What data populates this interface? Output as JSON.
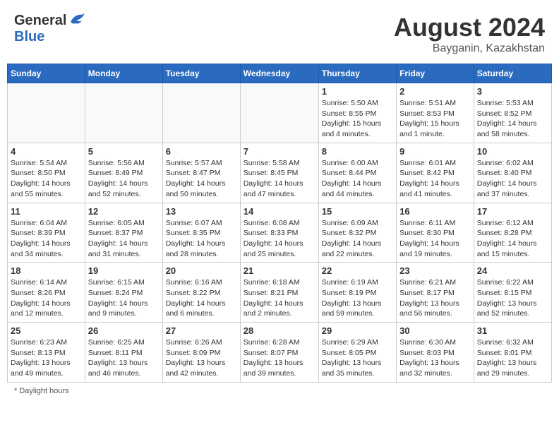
{
  "header": {
    "logo_general": "General",
    "logo_blue": "Blue",
    "month_year": "August 2024",
    "location": "Bayganin, Kazakhstan"
  },
  "days_of_week": [
    "Sunday",
    "Monday",
    "Tuesday",
    "Wednesday",
    "Thursday",
    "Friday",
    "Saturday"
  ],
  "footer": {
    "daylight_label": "Daylight hours"
  },
  "weeks": [
    [
      {
        "day": "",
        "info": ""
      },
      {
        "day": "",
        "info": ""
      },
      {
        "day": "",
        "info": ""
      },
      {
        "day": "",
        "info": ""
      },
      {
        "day": "1",
        "info": "Sunrise: 5:50 AM\nSunset: 8:55 PM\nDaylight: 15 hours\nand 4 minutes."
      },
      {
        "day": "2",
        "info": "Sunrise: 5:51 AM\nSunset: 8:53 PM\nDaylight: 15 hours\nand 1 minute."
      },
      {
        "day": "3",
        "info": "Sunrise: 5:53 AM\nSunset: 8:52 PM\nDaylight: 14 hours\nand 58 minutes."
      }
    ],
    [
      {
        "day": "4",
        "info": "Sunrise: 5:54 AM\nSunset: 8:50 PM\nDaylight: 14 hours\nand 55 minutes."
      },
      {
        "day": "5",
        "info": "Sunrise: 5:56 AM\nSunset: 8:49 PM\nDaylight: 14 hours\nand 52 minutes."
      },
      {
        "day": "6",
        "info": "Sunrise: 5:57 AM\nSunset: 8:47 PM\nDaylight: 14 hours\nand 50 minutes."
      },
      {
        "day": "7",
        "info": "Sunrise: 5:58 AM\nSunset: 8:45 PM\nDaylight: 14 hours\nand 47 minutes."
      },
      {
        "day": "8",
        "info": "Sunrise: 6:00 AM\nSunset: 8:44 PM\nDaylight: 14 hours\nand 44 minutes."
      },
      {
        "day": "9",
        "info": "Sunrise: 6:01 AM\nSunset: 8:42 PM\nDaylight: 14 hours\nand 41 minutes."
      },
      {
        "day": "10",
        "info": "Sunrise: 6:02 AM\nSunset: 8:40 PM\nDaylight: 14 hours\nand 37 minutes."
      }
    ],
    [
      {
        "day": "11",
        "info": "Sunrise: 6:04 AM\nSunset: 8:39 PM\nDaylight: 14 hours\nand 34 minutes."
      },
      {
        "day": "12",
        "info": "Sunrise: 6:05 AM\nSunset: 8:37 PM\nDaylight: 14 hours\nand 31 minutes."
      },
      {
        "day": "13",
        "info": "Sunrise: 6:07 AM\nSunset: 8:35 PM\nDaylight: 14 hours\nand 28 minutes."
      },
      {
        "day": "14",
        "info": "Sunrise: 6:08 AM\nSunset: 8:33 PM\nDaylight: 14 hours\nand 25 minutes."
      },
      {
        "day": "15",
        "info": "Sunrise: 6:09 AM\nSunset: 8:32 PM\nDaylight: 14 hours\nand 22 minutes."
      },
      {
        "day": "16",
        "info": "Sunrise: 6:11 AM\nSunset: 8:30 PM\nDaylight: 14 hours\nand 19 minutes."
      },
      {
        "day": "17",
        "info": "Sunrise: 6:12 AM\nSunset: 8:28 PM\nDaylight: 14 hours\nand 15 minutes."
      }
    ],
    [
      {
        "day": "18",
        "info": "Sunrise: 6:14 AM\nSunset: 8:26 PM\nDaylight: 14 hours\nand 12 minutes."
      },
      {
        "day": "19",
        "info": "Sunrise: 6:15 AM\nSunset: 8:24 PM\nDaylight: 14 hours\nand 9 minutes."
      },
      {
        "day": "20",
        "info": "Sunrise: 6:16 AM\nSunset: 8:22 PM\nDaylight: 14 hours\nand 6 minutes."
      },
      {
        "day": "21",
        "info": "Sunrise: 6:18 AM\nSunset: 8:21 PM\nDaylight: 14 hours\nand 2 minutes."
      },
      {
        "day": "22",
        "info": "Sunrise: 6:19 AM\nSunset: 8:19 PM\nDaylight: 13 hours\nand 59 minutes."
      },
      {
        "day": "23",
        "info": "Sunrise: 6:21 AM\nSunset: 8:17 PM\nDaylight: 13 hours\nand 56 minutes."
      },
      {
        "day": "24",
        "info": "Sunrise: 6:22 AM\nSunset: 8:15 PM\nDaylight: 13 hours\nand 52 minutes."
      }
    ],
    [
      {
        "day": "25",
        "info": "Sunrise: 6:23 AM\nSunset: 8:13 PM\nDaylight: 13 hours\nand 49 minutes."
      },
      {
        "day": "26",
        "info": "Sunrise: 6:25 AM\nSunset: 8:11 PM\nDaylight: 13 hours\nand 46 minutes."
      },
      {
        "day": "27",
        "info": "Sunrise: 6:26 AM\nSunset: 8:09 PM\nDaylight: 13 hours\nand 42 minutes."
      },
      {
        "day": "28",
        "info": "Sunrise: 6:28 AM\nSunset: 8:07 PM\nDaylight: 13 hours\nand 39 minutes."
      },
      {
        "day": "29",
        "info": "Sunrise: 6:29 AM\nSunset: 8:05 PM\nDaylight: 13 hours\nand 35 minutes."
      },
      {
        "day": "30",
        "info": "Sunrise: 6:30 AM\nSunset: 8:03 PM\nDaylight: 13 hours\nand 32 minutes."
      },
      {
        "day": "31",
        "info": "Sunrise: 6:32 AM\nSunset: 8:01 PM\nDaylight: 13 hours\nand 29 minutes."
      }
    ]
  ]
}
